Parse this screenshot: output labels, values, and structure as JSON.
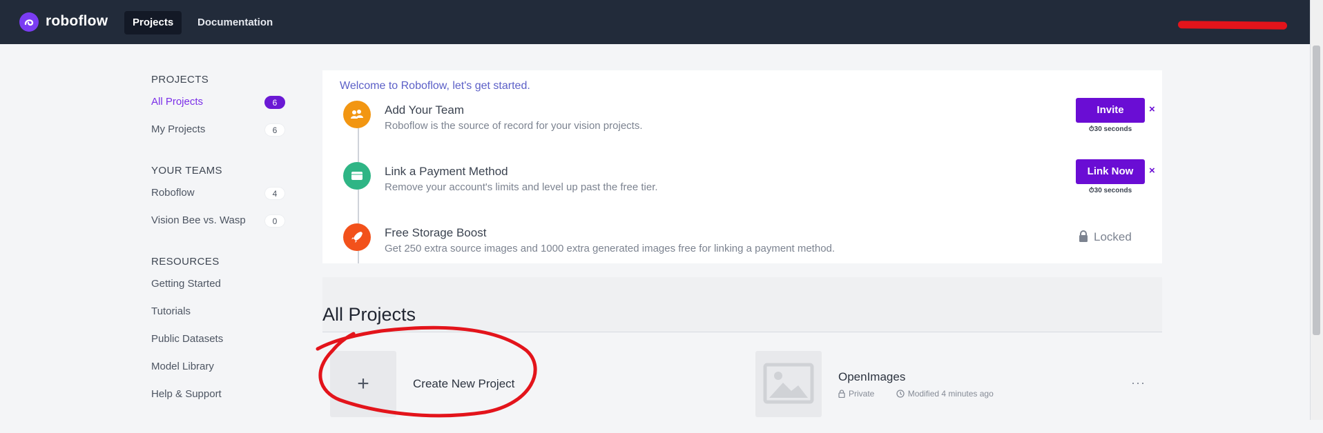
{
  "nav": {
    "brand": "roboflow",
    "tabs": [
      {
        "label": "Projects",
        "active": true
      },
      {
        "label": "Documentation",
        "active": false
      }
    ]
  },
  "sidebar": {
    "projects_heading": "PROJECTS",
    "projects": [
      {
        "label": "All Projects",
        "count": "6",
        "active": true
      },
      {
        "label": "My Projects",
        "count": "6",
        "active": false
      }
    ],
    "teams_heading": "YOUR TEAMS",
    "teams": [
      {
        "label": "Roboflow",
        "count": "4"
      },
      {
        "label": "Vision Bee vs. Wasp",
        "count": "0"
      }
    ],
    "resources_heading": "RESOURCES",
    "resources": [
      "Getting Started",
      "Tutorials",
      "Public Datasets",
      "Model Library",
      "Help & Support"
    ]
  },
  "welcome": {
    "title": "Welcome to Roboflow, let's get started.",
    "steps": [
      {
        "icon": "team-icon",
        "color": "#f29612",
        "title": "Add Your Team",
        "desc": "Roboflow is the source of record for your vision projects.",
        "button": "Invite",
        "time": "30 seconds",
        "dismiss": "×"
      },
      {
        "icon": "wallet-icon",
        "color": "#2fb585",
        "title": "Link a Payment Method",
        "desc": "Remove your account's limits and level up past the free tier.",
        "button": "Link Now",
        "time": "30 seconds",
        "dismiss": "×"
      },
      {
        "icon": "rocket-icon",
        "color": "#f2511b",
        "title": "Free Storage Boost",
        "desc": "Get 250 extra source images and 1000 extra generated images free for linking a payment method.",
        "status": "Locked"
      }
    ]
  },
  "all_projects": {
    "heading": "All Projects",
    "create_label": "Create New Project",
    "create_symbol": "+",
    "project": {
      "name": "OpenImages",
      "visibility": "Private",
      "modified": "Modified 4 minutes ago",
      "menu": "···"
    }
  },
  "colors": {
    "accent": "#6a0dd4",
    "nav_bg": "#222b3a",
    "annotation": "#e3141b"
  }
}
